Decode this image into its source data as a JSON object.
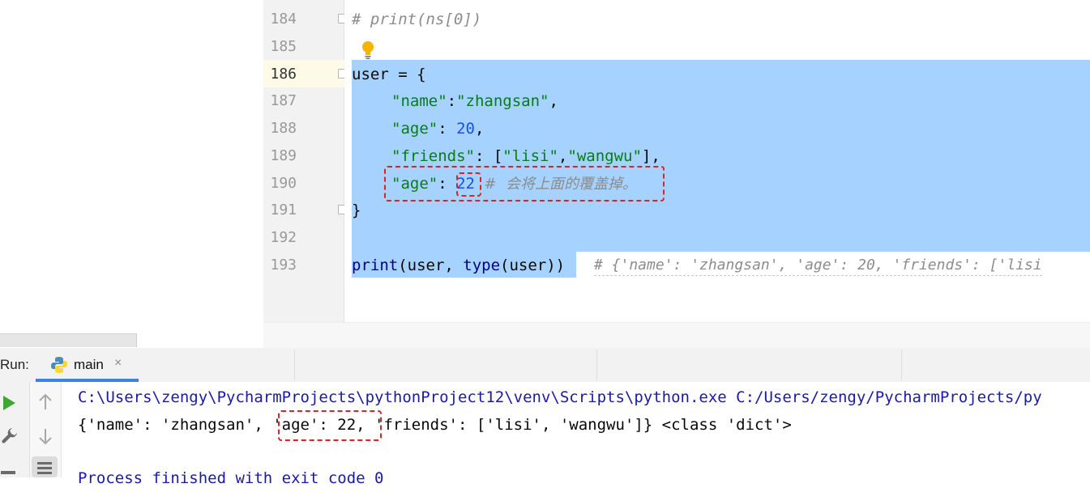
{
  "editor": {
    "line_numbers": [
      "184",
      "185",
      "186",
      "187",
      "188",
      "189",
      "190",
      "191",
      "192",
      "193"
    ],
    "lines": {
      "l184": "# print(ns[0])",
      "l186_var": "user",
      "l186_rest": " = {",
      "l187_key": "\"name\"",
      "l187_sep": ":",
      "l187_val": "\"zhangsan\"",
      "l187_end": ",",
      "l188_key": "\"age\"",
      "l188_sep": ": ",
      "l188_val": "20",
      "l188_end": ",",
      "l189_key": "\"friends\"",
      "l189_sep": ": [",
      "l189_v1": "\"lisi\"",
      "l189_comma": ",",
      "l189_v2": "\"wangwu\"",
      "l189_end": "],",
      "l190_key": "\"age\"",
      "l190_sep": ": ",
      "l190_val": "22",
      "l190_comment": "  #  会将上面的覆盖掉。",
      "l191": "}",
      "l193_fn": "print",
      "l193_a": "(user, ",
      "l193_type": "type",
      "l193_b": "(user))",
      "l193_hint": "# {'name': 'zhangsan', 'age': 20, 'friends': ['lisi"
    }
  },
  "run_panel": {
    "label": "Run:",
    "tab_label": "main",
    "tab_close": "×"
  },
  "console": {
    "line1": "C:\\Users\\zengy\\PycharmProjects\\pythonProject12\\venv\\Scripts\\python.exe C:/Users/zengy/PycharmProjects/py",
    "line2_a": "{'name': 'zhangsan', ",
    "line2_b": "'age': 22,",
    "line2_c": " 'friends': ['lisi', 'wangwu']} <class 'dict'>",
    "line3": "Process finished with exit code 0"
  },
  "colors": {
    "selection": "#a6d2ff",
    "annotation_box": "#e0202a",
    "tab_underline": "#3d83e0",
    "run_icon": "#3fa535"
  }
}
